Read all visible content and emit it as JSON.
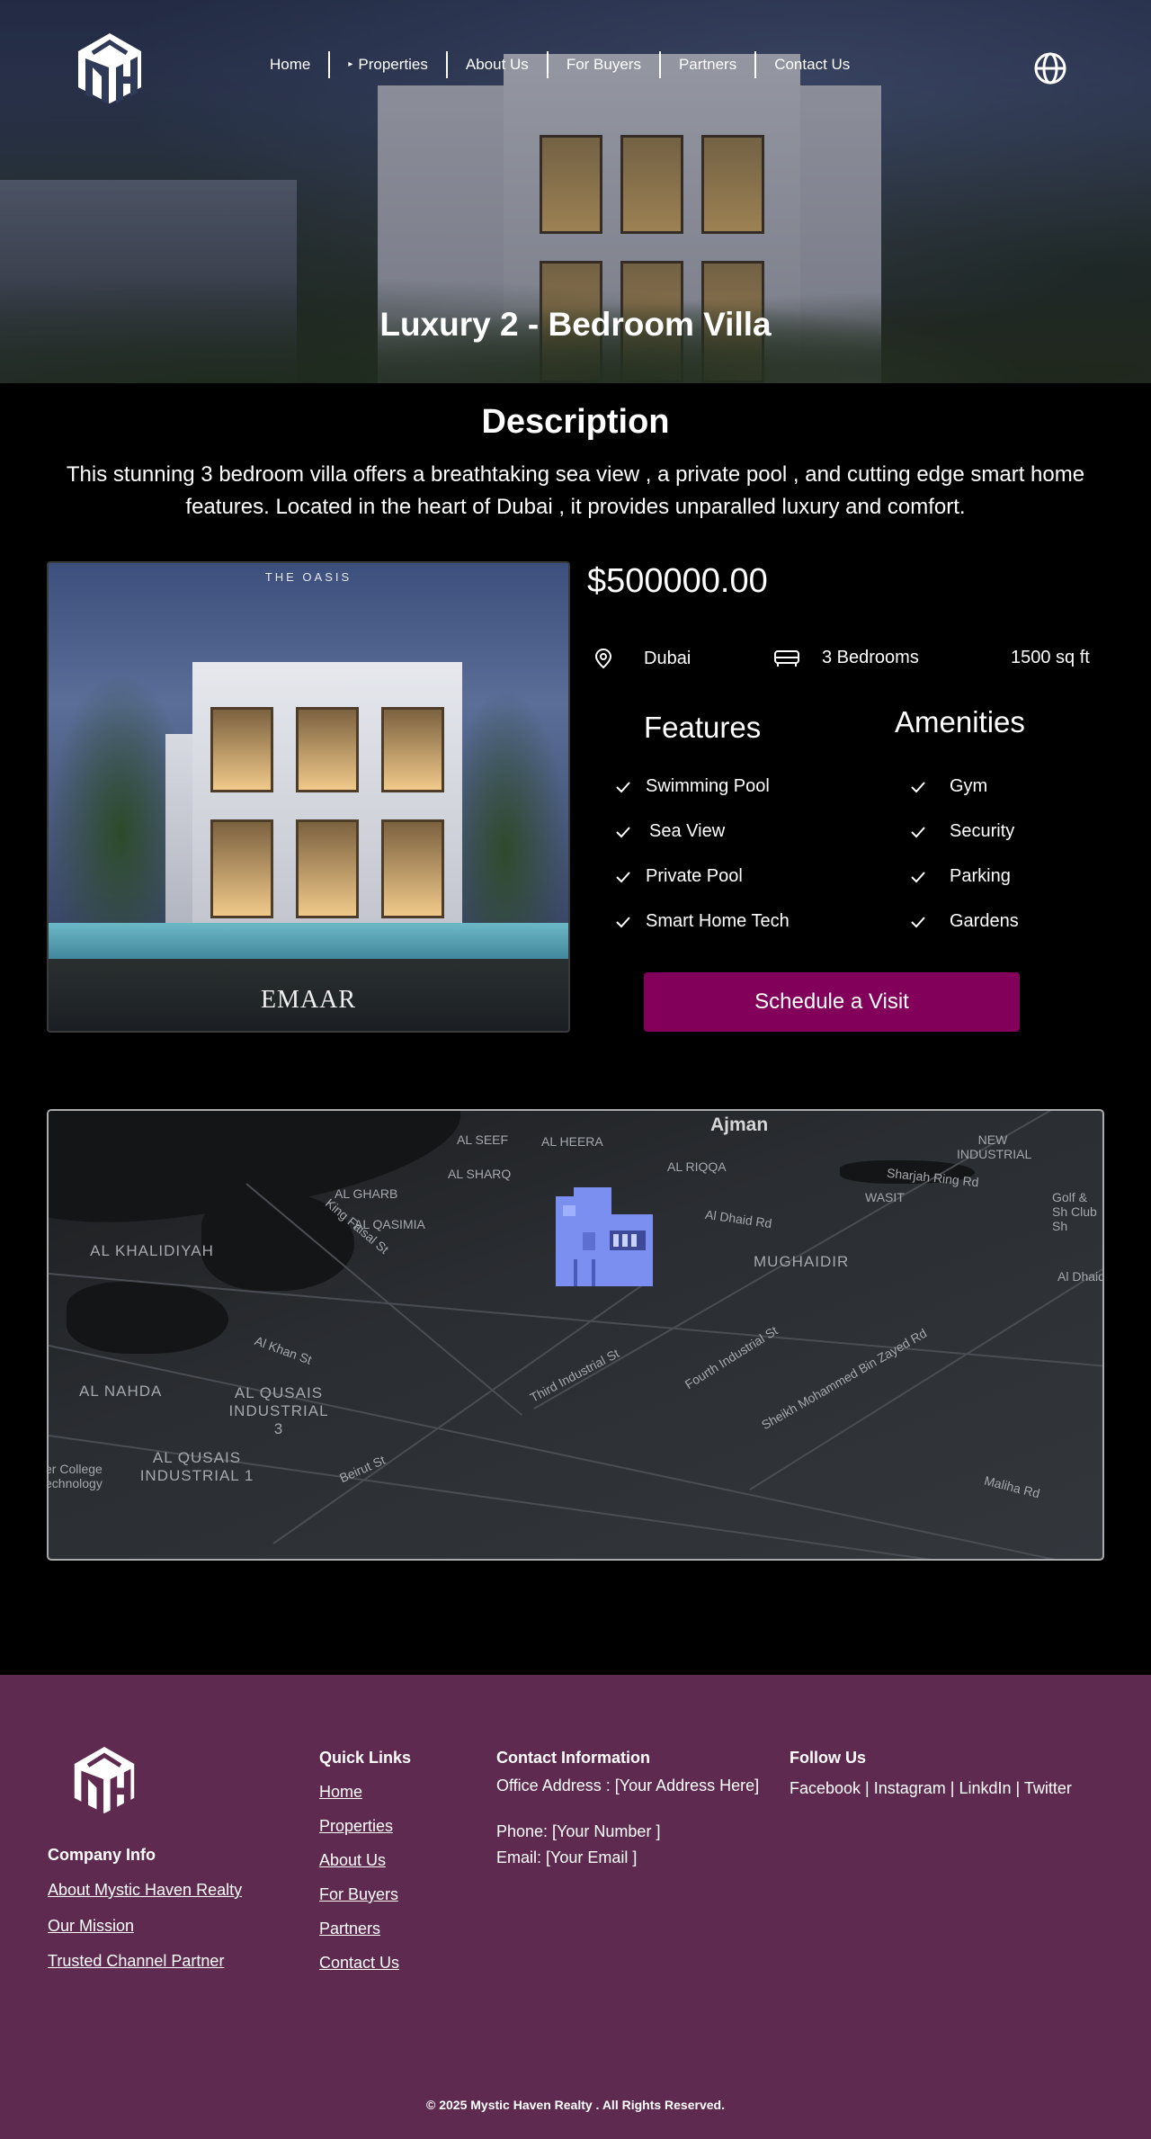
{
  "nav": {
    "items": [
      {
        "label": "Home"
      },
      {
        "label": "Properties",
        "has_caret": true
      },
      {
        "label": "About Us"
      },
      {
        "label": "For Buyers"
      },
      {
        "label": "Partners"
      },
      {
        "label": "Contact Us"
      }
    ],
    "caret_glyph": "▸",
    "logo_icon": "mh-logo-icon",
    "language_icon": "globe-icon"
  },
  "hero": {
    "title": "Luxury 2 - Bedroom Villa"
  },
  "description": {
    "heading": "Description",
    "text": "This stunning 3 bedroom villa offers a breathtaking sea view , a private pool , and cutting edge smart home features. Located in the heart of Dubai , it provides unparalled luxury and comfort."
  },
  "property": {
    "photo_top_label": "THE OASIS",
    "photo_bottom_label": "EMAAR",
    "price": "$500000.00",
    "location": "Dubai",
    "bedrooms": "3 Bedrooms",
    "area": "1500 sq ft",
    "features_heading": "Features",
    "amenities_heading": "Amenities",
    "features": [
      "Swimming Pool",
      "Sea View",
      "Private Pool",
      "Smart Home Tech"
    ],
    "amenities": [
      "Gym",
      "Security",
      "Parking",
      "Gardens"
    ],
    "cta_label": "Schedule a Visit"
  },
  "map": {
    "labels": {
      "ajman": "Ajman",
      "al_seef": "AL SEEF",
      "al_heera": "AL HEERA",
      "al_sharq": "AL SHARQ",
      "al_riqqa": "AL RIQQA",
      "al_gharb": "AL GHARB",
      "al_qasimia": "AL QASIMIA",
      "wasit": "WASIT",
      "new_industrial": "NEW INDUSTRIAL",
      "al_khalidiyah": "AL KHALIDIYAH",
      "mughaidir": "MUGHAIDIR",
      "al_nahda": "AL NAHDA",
      "al_qusais_3": "AL QUSAIS INDUSTRIAL 3",
      "al_qusais_1": "AL QUSAIS INDUSTRIAL 1",
      "sharjah_ring": "Sharjah Ring Rd",
      "king_faisal": "King Faisal St",
      "al_dhaid": "Al Dhaid Rd",
      "al_khan": "Al Khan St",
      "third_industrial": "Third Industrial St",
      "fourth_industrial": "Fourth Industrial St",
      "sheikh_mohammed": "Sheikh Mohammed Bin Zayed Rd",
      "beirut": "Beirut St",
      "maliha": "Maliha Rd",
      "golf": "Golf & Sh Club Sh",
      "college": "er College echnology",
      "al_dhaid_edge": "Al Dhaid"
    },
    "pin_icon": "building-map-pin-icon"
  },
  "footer": {
    "company_heading": "Company Info",
    "company_links": [
      "About Mystic Haven Realty",
      "Our Mission",
      "Trusted Channel Partner"
    ],
    "quick_heading": "Quick Links",
    "quick_links": [
      "Home",
      "Properties",
      "About Us",
      "For Buyers",
      "Partners",
      "Contact Us"
    ],
    "contact_heading": "Contact Information",
    "office": "Office Address : [Your Address Here]",
    "phone": "Phone: [Your Number ]",
    "email": "Email: [Your Email ]",
    "follow_heading": "Follow Us",
    "social": "Facebook | Instagram | LinkdIn | Twitter",
    "copyright": "© 2025 Mystic Haven Realty . All Rights Reserved."
  },
  "colors": {
    "cta": "#82005a",
    "footer_bg": "#5f2a50",
    "map_pin": "#7b8ff0"
  }
}
